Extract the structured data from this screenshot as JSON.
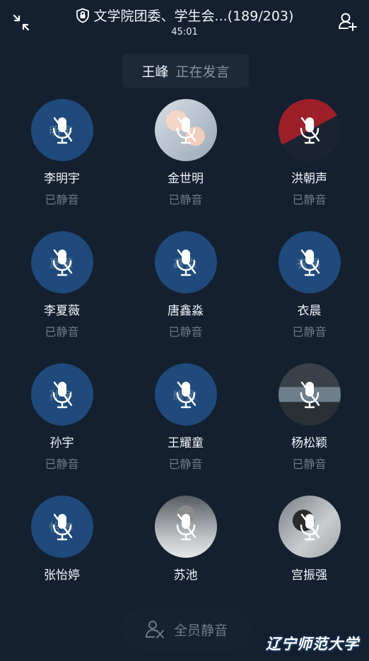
{
  "header": {
    "title": "文学院团委、学生会...(189/203)",
    "timer": "45:01"
  },
  "speaking": {
    "name": "王峰",
    "status": "正在发言"
  },
  "members": [
    {
      "name": "李明宇",
      "status": "已静音",
      "avatar_text": "明宇",
      "avatar": "blue"
    },
    {
      "name": "金世明",
      "status": "已静音",
      "avatar_text": "",
      "avatar": "photo-cartoon"
    },
    {
      "name": "洪朝声",
      "status": "已静音",
      "avatar_text": "",
      "avatar": "photo-split"
    },
    {
      "name": "李夏薇",
      "status": "已静音",
      "avatar_text": "夏薇",
      "avatar": "blue"
    },
    {
      "name": "唐鑫淼",
      "status": "已静音",
      "avatar_text": "鑫淼",
      "avatar": "blue"
    },
    {
      "name": "衣晨",
      "status": "已静音",
      "avatar_text": "衣晨",
      "avatar": "blue"
    },
    {
      "name": "孙宇",
      "status": "已静音",
      "avatar_text": "孙宇",
      "avatar": "blue"
    },
    {
      "name": "王耀童",
      "status": "已静音",
      "avatar_text": "耀童",
      "avatar": "blue"
    },
    {
      "name": "杨松颖",
      "status": "已静音",
      "avatar_text": "",
      "avatar": "photo-room"
    },
    {
      "name": "张怡婷",
      "status": "",
      "avatar_text": "怡婷",
      "avatar": "blue"
    },
    {
      "name": "苏池",
      "status": "",
      "avatar_text": "",
      "avatar": "photo-man"
    },
    {
      "name": "宫振强",
      "status": "",
      "avatar_text": "",
      "avatar": "photo-girl"
    }
  ],
  "footer": {
    "mute_all_label": "全员静音"
  },
  "watermark": "辽宁师范大学",
  "colors": {
    "background": "#142030",
    "avatar_blue": "#1f4a7b",
    "muted_text": "#6f7a86"
  },
  "icons": {
    "collapse": "collapse-arrows-icon",
    "lock": "lock-shield-icon",
    "add_user": "add-user-icon",
    "mic_off": "mic-off-icon",
    "mute_all": "mute-all-icon"
  }
}
